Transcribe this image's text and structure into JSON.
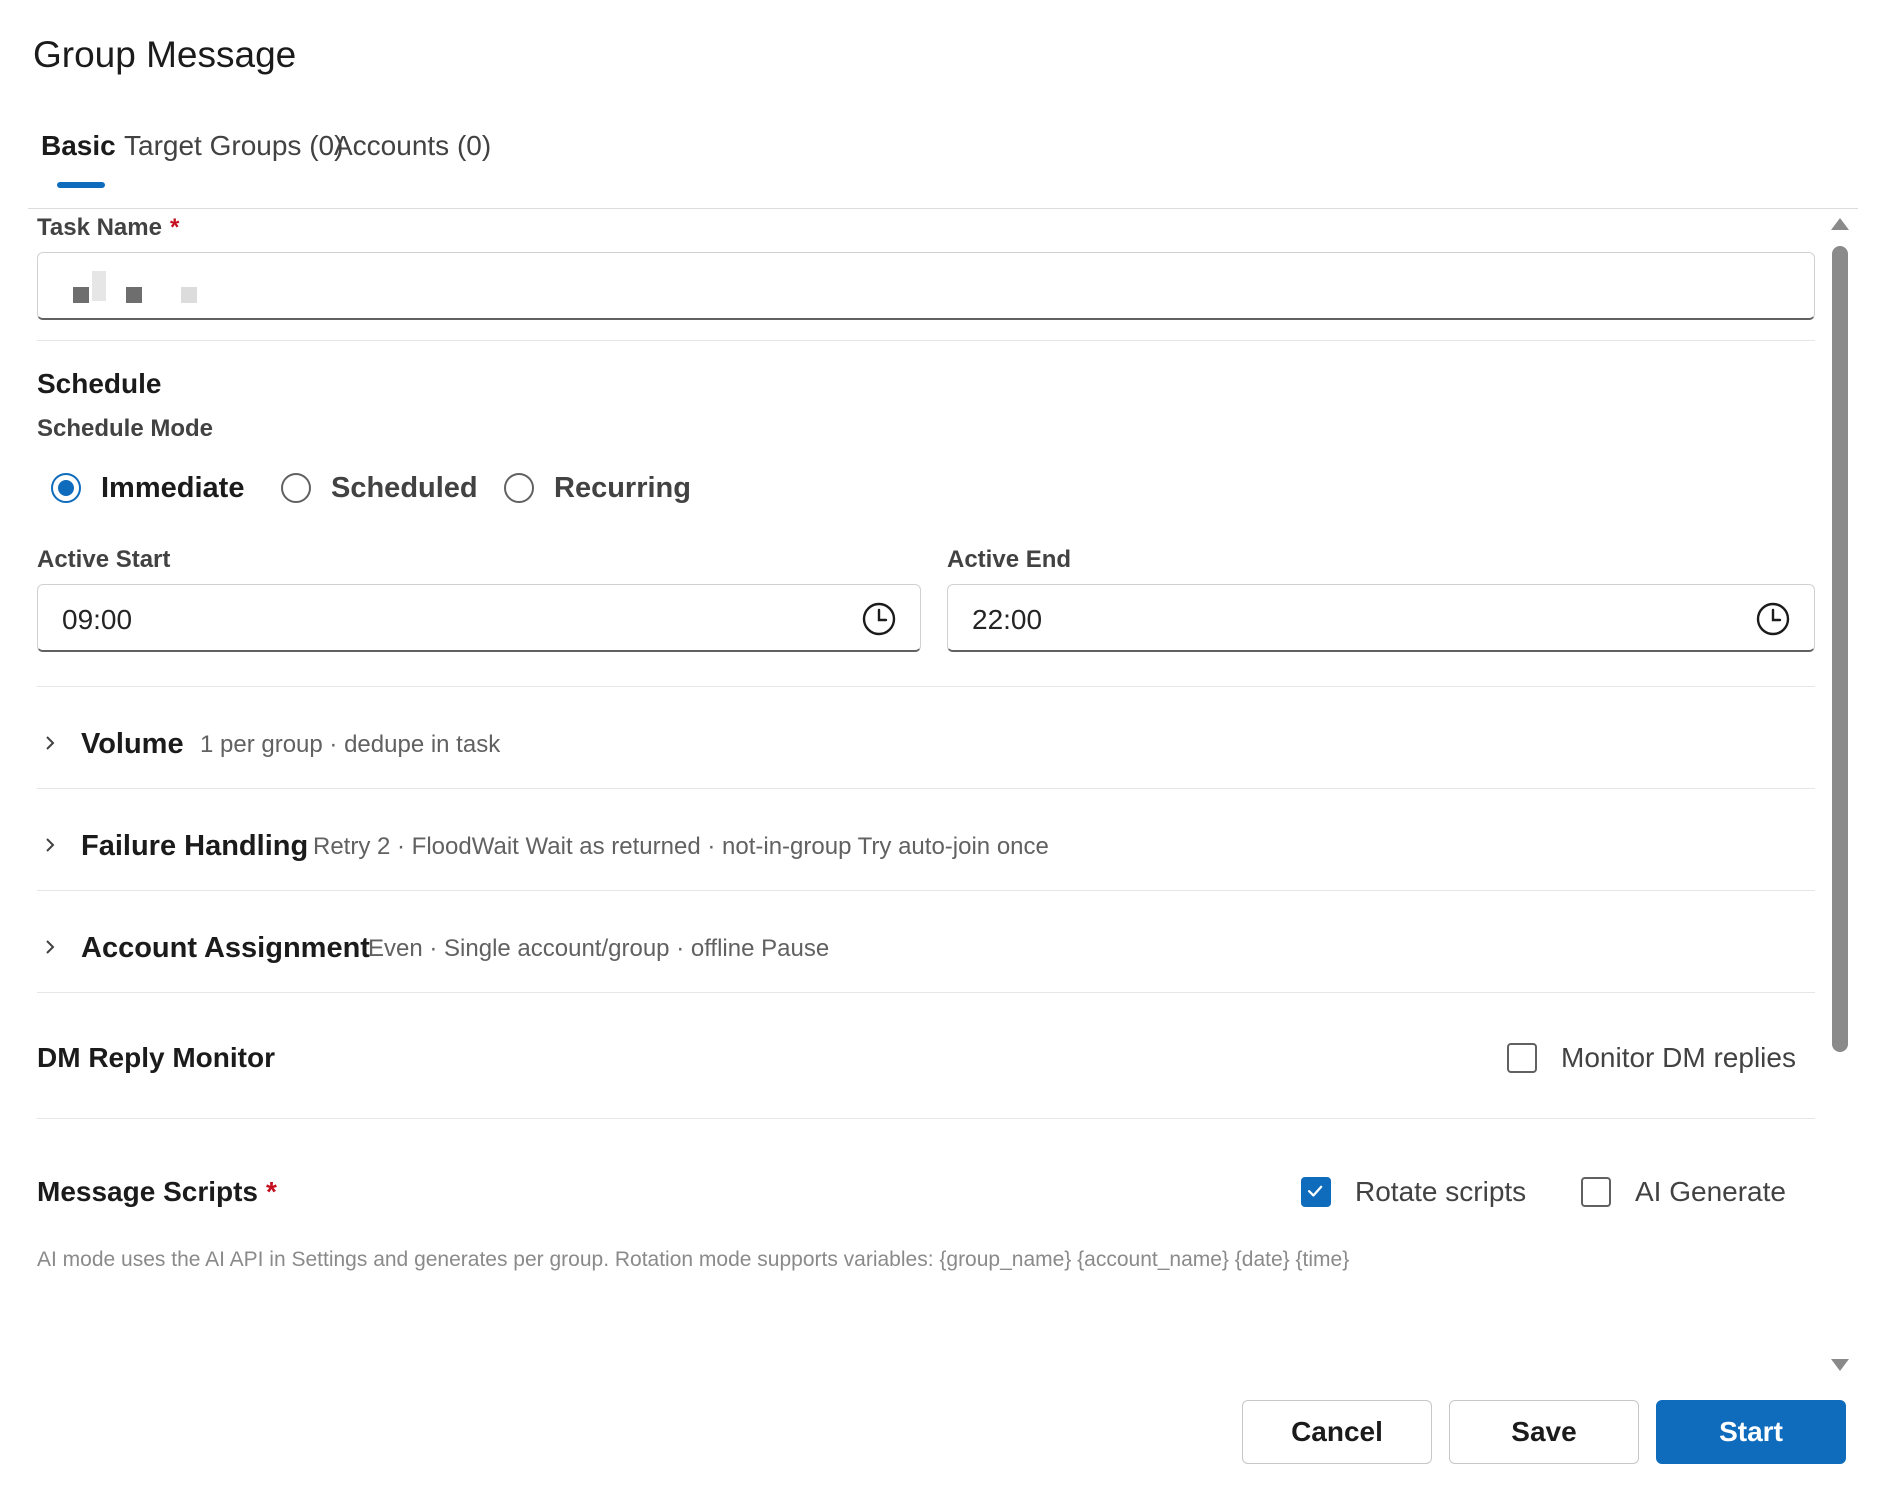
{
  "dialog": {
    "title": "Group Message"
  },
  "tabs": [
    {
      "label": "Basic",
      "active": true
    },
    {
      "label": "Target Groups (0)",
      "active": false
    },
    {
      "label": "Accounts (0)",
      "active": false
    }
  ],
  "task_name": {
    "label": "Task Name",
    "required_mark": "*",
    "value": ""
  },
  "schedule": {
    "title": "Schedule",
    "mode_label": "Schedule Mode",
    "modes": [
      {
        "label": "Immediate",
        "selected": true
      },
      {
        "label": "Scheduled",
        "selected": false
      },
      {
        "label": "Recurring",
        "selected": false
      }
    ],
    "active_start": {
      "label": "Active Start",
      "value": "09:00",
      "icon": "clock-icon"
    },
    "active_end": {
      "label": "Active End",
      "value": "22:00",
      "icon": "clock-icon"
    }
  },
  "collapsibles": [
    {
      "title": "Volume",
      "summary": "1 per group · dedupe in task",
      "expanded": false
    },
    {
      "title": "Failure Handling",
      "summary": "Retry 2 · FloodWait Wait as returned · not-in-group Try auto-join once",
      "expanded": false
    },
    {
      "title": "Account Assignment",
      "summary": "Even · Single account/group · offline Pause",
      "expanded": false
    }
  ],
  "dm_monitor": {
    "title": "DM Reply Monitor",
    "checkbox_label": "Monitor DM replies",
    "checked": false
  },
  "message_scripts": {
    "title": "Message Scripts",
    "required_mark": "*",
    "rotate": {
      "label": "Rotate scripts",
      "checked": true
    },
    "ai": {
      "label": "AI Generate",
      "checked": false
    },
    "hint": "AI mode uses the AI API in Settings and generates per group. Rotation mode supports variables: {group_name} {account_name} {date} {time}"
  },
  "footer": {
    "cancel": "Cancel",
    "save": "Save",
    "start": "Start"
  },
  "colors": {
    "accent": "#0f6cbd",
    "required": "#c50f1f"
  }
}
